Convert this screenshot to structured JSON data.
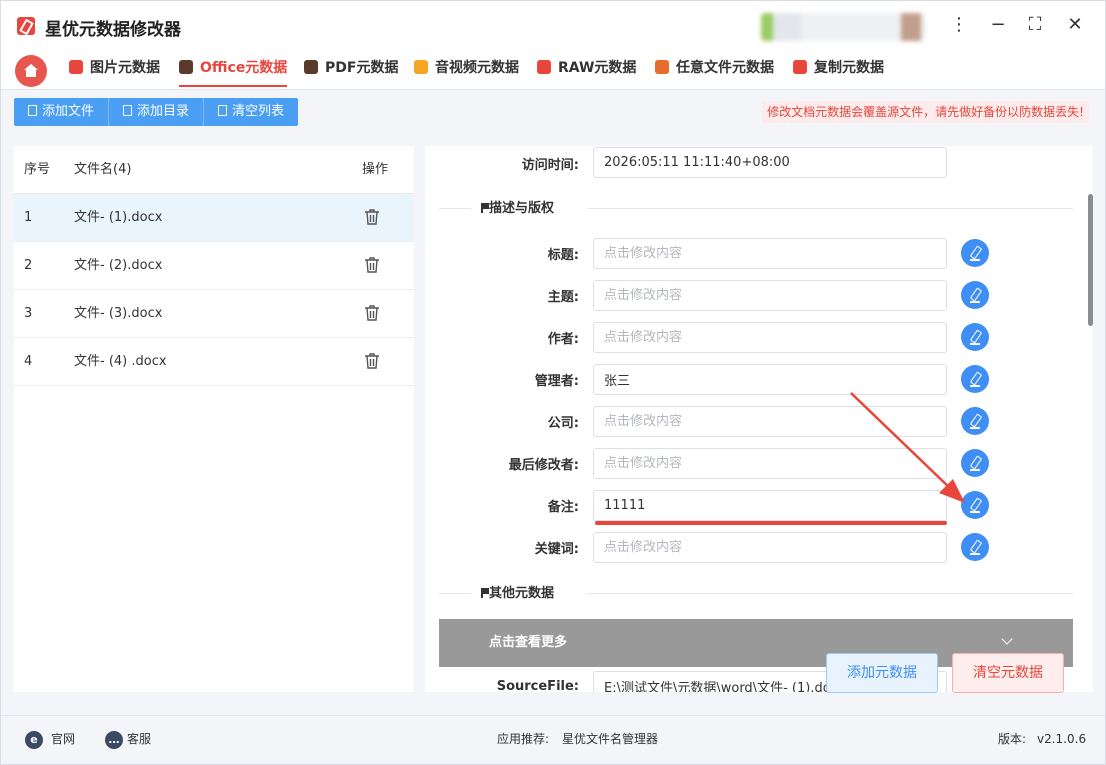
{
  "app": {
    "title": "星优元数据修改器"
  },
  "tabs": [
    {
      "label": "图片元数据",
      "icon": "image-icon",
      "color": "#e8453c"
    },
    {
      "label": "Office元数据",
      "icon": "office-icon",
      "color": "#5a3a2a"
    },
    {
      "label": "PDF元数据",
      "icon": "pdf-icon",
      "color": "#5a3a2a"
    },
    {
      "label": "音视频元数据",
      "icon": "media-icon",
      "color": "#f5a623"
    },
    {
      "label": "RAW元数据",
      "icon": "raw-icon",
      "color": "#e8453c"
    },
    {
      "label": "任意文件元数据",
      "icon": "file-icon",
      "color": "#e86c2c"
    },
    {
      "label": "复制元数据",
      "icon": "copy-icon",
      "color": "#e8453c"
    }
  ],
  "toolbar": {
    "add_file": "添加文件",
    "add_dir": "添加目录",
    "clear_list": "清空列表",
    "warning": "修改文档元数据会覆盖源文件，请先做好备份以防数据丢失!"
  },
  "file_list": {
    "col_index": "序号",
    "col_name": "文件名(4)",
    "col_action": "操作",
    "rows": [
      {
        "index": "1",
        "name": "文件- (1).docx"
      },
      {
        "index": "2",
        "name": "文件- (2).docx"
      },
      {
        "index": "3",
        "name": "文件- (3).docx"
      },
      {
        "index": "4",
        "name": "文件- (4) .docx"
      }
    ]
  },
  "form": {
    "access_time_label": "访问时间:",
    "access_time_value": "2026:05:11 11:11:40+08:00",
    "section_desc": "描述与版权",
    "placeholder": "点击修改内容",
    "fields": [
      {
        "label": "标题:",
        "value": ""
      },
      {
        "label": "主题:",
        "value": ""
      },
      {
        "label": "作者:",
        "value": ""
      },
      {
        "label": "管理者:",
        "value": "张三"
      },
      {
        "label": "公司:",
        "value": ""
      },
      {
        "label": "最后修改者:",
        "value": ""
      },
      {
        "label": "备注:",
        "value": "11111"
      },
      {
        "label": "关键词:",
        "value": ""
      }
    ],
    "section_other": "其他元数据",
    "more": "点击查看更多",
    "source_label": "SourceFile:",
    "source_value": "E:\\测试文件\\元数据\\word\\文件- (1).docx"
  },
  "actions": {
    "add_meta": "添加元数据",
    "clear_meta": "清空元数据"
  },
  "status": {
    "site": "官网",
    "service": "客服",
    "recommend_label": "应用推荐:",
    "recommend_value": "星优文件名管理器",
    "version_label": "版本:",
    "version_value": "v2.1.0.6"
  },
  "colors": {
    "accent": "#e8453c",
    "primary": "#4a9ff5"
  }
}
